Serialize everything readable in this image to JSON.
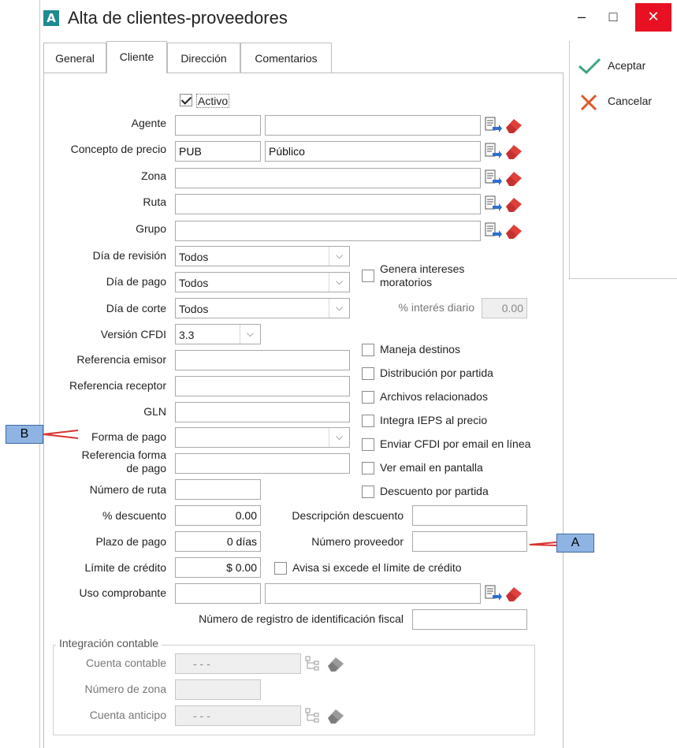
{
  "window": {
    "title": "Alta de clientes-proveedores",
    "app_logo": "A",
    "minimize": "–",
    "maximize": "□",
    "close": "✕"
  },
  "tabs": [
    "General",
    "Cliente",
    "Dirección",
    "Comentarios"
  ],
  "actions": {
    "accept": "Aceptar",
    "cancel": "Cancelar",
    "accept_color": "#3aa57a",
    "cancel_color": "#e05a2a"
  },
  "form": {
    "activo": {
      "label": "Activo",
      "checked": true
    },
    "agente": {
      "label": "Agente",
      "code": "",
      "name": ""
    },
    "concepto_precio": {
      "label": "Concepto de precio",
      "code": "PUB",
      "name": "Público"
    },
    "zona": {
      "label": "Zona",
      "value": ""
    },
    "ruta": {
      "label": "Ruta",
      "value": ""
    },
    "grupo": {
      "label": "Grupo",
      "value": ""
    },
    "dia_revision": {
      "label": "Día de revisión",
      "value": "Todos"
    },
    "dia_pago": {
      "label": "Día de pago",
      "value": "Todos"
    },
    "dia_corte": {
      "label": "Día de corte",
      "value": "Todos"
    },
    "version_cfdi": {
      "label": "Versión CFDI",
      "value": "3.3"
    },
    "referencia_emisor": {
      "label": "Referencia emisor",
      "value": ""
    },
    "referencia_receptor": {
      "label": "Referencia receptor",
      "value": ""
    },
    "gln": {
      "label": "GLN",
      "value": ""
    },
    "forma_pago": {
      "label": "Forma de pago",
      "value": ""
    },
    "referencia_forma_pago": {
      "label_line1": "Referencia forma",
      "label_line2": "de pago",
      "value": ""
    },
    "numero_ruta": {
      "label": "Número de ruta",
      "value": ""
    },
    "descuento": {
      "label": "% descuento",
      "value": "0.00"
    },
    "plazo_pago": {
      "label": "Plazo de pago",
      "value": "0 días"
    },
    "limite_credito": {
      "label": "Límite de crédito",
      "value": "$ 0.00"
    },
    "uso_comprobante": {
      "label": "Uso comprobante",
      "code": "",
      "name": ""
    },
    "descripcion_descuento": {
      "label": "Descripción descuento",
      "value": ""
    },
    "numero_proveedor": {
      "label": "Número proveedor",
      "value": ""
    },
    "avisa_excede": {
      "label": "Avisa si excede el límite de crédito",
      "checked": false
    },
    "registro_fiscal": {
      "label": "Número de registro de identificación fiscal",
      "value": ""
    },
    "genera_intereses": {
      "label_line1": "Genera intereses",
      "label_line2": "moratorios",
      "checked": false
    },
    "interes_diario": {
      "label": "% interés diario",
      "value": "0.00"
    },
    "checkboxes": [
      {
        "label": "Maneja destinos",
        "checked": false
      },
      {
        "label": "Distribución por partida",
        "checked": false
      },
      {
        "label": "Archivos relacionados",
        "checked": false
      },
      {
        "label": "Integra IEPS al precio",
        "checked": false
      },
      {
        "label": "Enviar CFDI por email en línea",
        "checked": false
      },
      {
        "label": "Ver email en pantalla",
        "checked": false
      },
      {
        "label": "Descuento por partida",
        "checked": false
      }
    ]
  },
  "integracion": {
    "title": "Integración contable",
    "cuenta_contable": {
      "label": "Cuenta contable",
      "value": "-   -   -"
    },
    "numero_zona": {
      "label": "Número de zona",
      "value": ""
    },
    "cuenta_anticipo": {
      "label": "Cuenta anticipo",
      "value": "-   -   -"
    }
  },
  "callouts": {
    "a": "A",
    "b": "B"
  }
}
